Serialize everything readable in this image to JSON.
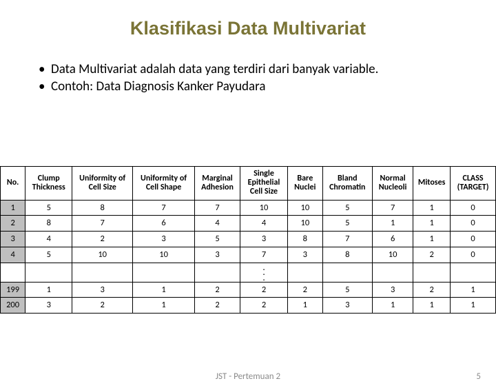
{
  "title": "Klasifikasi Data Multivariat",
  "bullets": [
    "Data Multivariat adalah data yang terdiri dari banyak variable.",
    "Contoh: Data Diagnosis Kanker Payudara"
  ],
  "headers": [
    "No.",
    "Clump Thickness",
    "Uniformity of Cell Size",
    "Uniformity of Cell Shape",
    "Marginal Adhesion",
    "Single Epithelial Cell Size",
    "Bare Nuclei",
    "Bland Chromatin",
    "Normal Nucleoli",
    "Mitoses",
    "CLASS (TARGET)"
  ],
  "rows_top": [
    [
      "1",
      "5",
      "8",
      "7",
      "7",
      "10",
      "10",
      "5",
      "7",
      "1",
      "0"
    ],
    [
      "2",
      "8",
      "7",
      "6",
      "4",
      "4",
      "10",
      "5",
      "1",
      "1",
      "0"
    ],
    [
      "3",
      "4",
      "2",
      "3",
      "5",
      "3",
      "8",
      "7",
      "6",
      "1",
      "0"
    ],
    [
      "4",
      "5",
      "10",
      "10",
      "3",
      "7",
      "3",
      "8",
      "10",
      "2",
      "0"
    ]
  ],
  "rows_bottom": [
    [
      "199",
      "1",
      "3",
      "1",
      "2",
      "2",
      "2",
      "5",
      "3",
      "2",
      "1"
    ],
    [
      "200",
      "3",
      "2",
      "1",
      "2",
      "2",
      "1",
      "3",
      "1",
      "1",
      "1"
    ]
  ],
  "footer_center": "JST - Pertemuan 2",
  "footer_page": "5",
  "chart_data": {
    "type": "table",
    "title": "Klasifikasi Data Multivariat",
    "columns": [
      "No.",
      "Clump Thickness",
      "Uniformity of Cell Size",
      "Uniformity of Cell Shape",
      "Marginal Adhesion",
      "Single Epithelial Cell Size",
      "Bare Nuclei",
      "Bland Chromatin",
      "Normal Nucleoli",
      "Mitoses",
      "CLASS (TARGET)"
    ],
    "rows": [
      [
        1,
        5,
        8,
        7,
        7,
        10,
        10,
        5,
        7,
        1,
        0
      ],
      [
        2,
        8,
        7,
        6,
        4,
        4,
        10,
        5,
        1,
        1,
        0
      ],
      [
        3,
        4,
        2,
        3,
        5,
        3,
        8,
        7,
        6,
        1,
        0
      ],
      [
        4,
        5,
        10,
        10,
        3,
        7,
        3,
        8,
        10,
        2,
        0
      ],
      [
        199,
        1,
        3,
        1,
        2,
        2,
        2,
        5,
        3,
        2,
        1
      ],
      [
        200,
        3,
        2,
        1,
        2,
        2,
        1,
        3,
        1,
        1,
        1
      ]
    ]
  }
}
